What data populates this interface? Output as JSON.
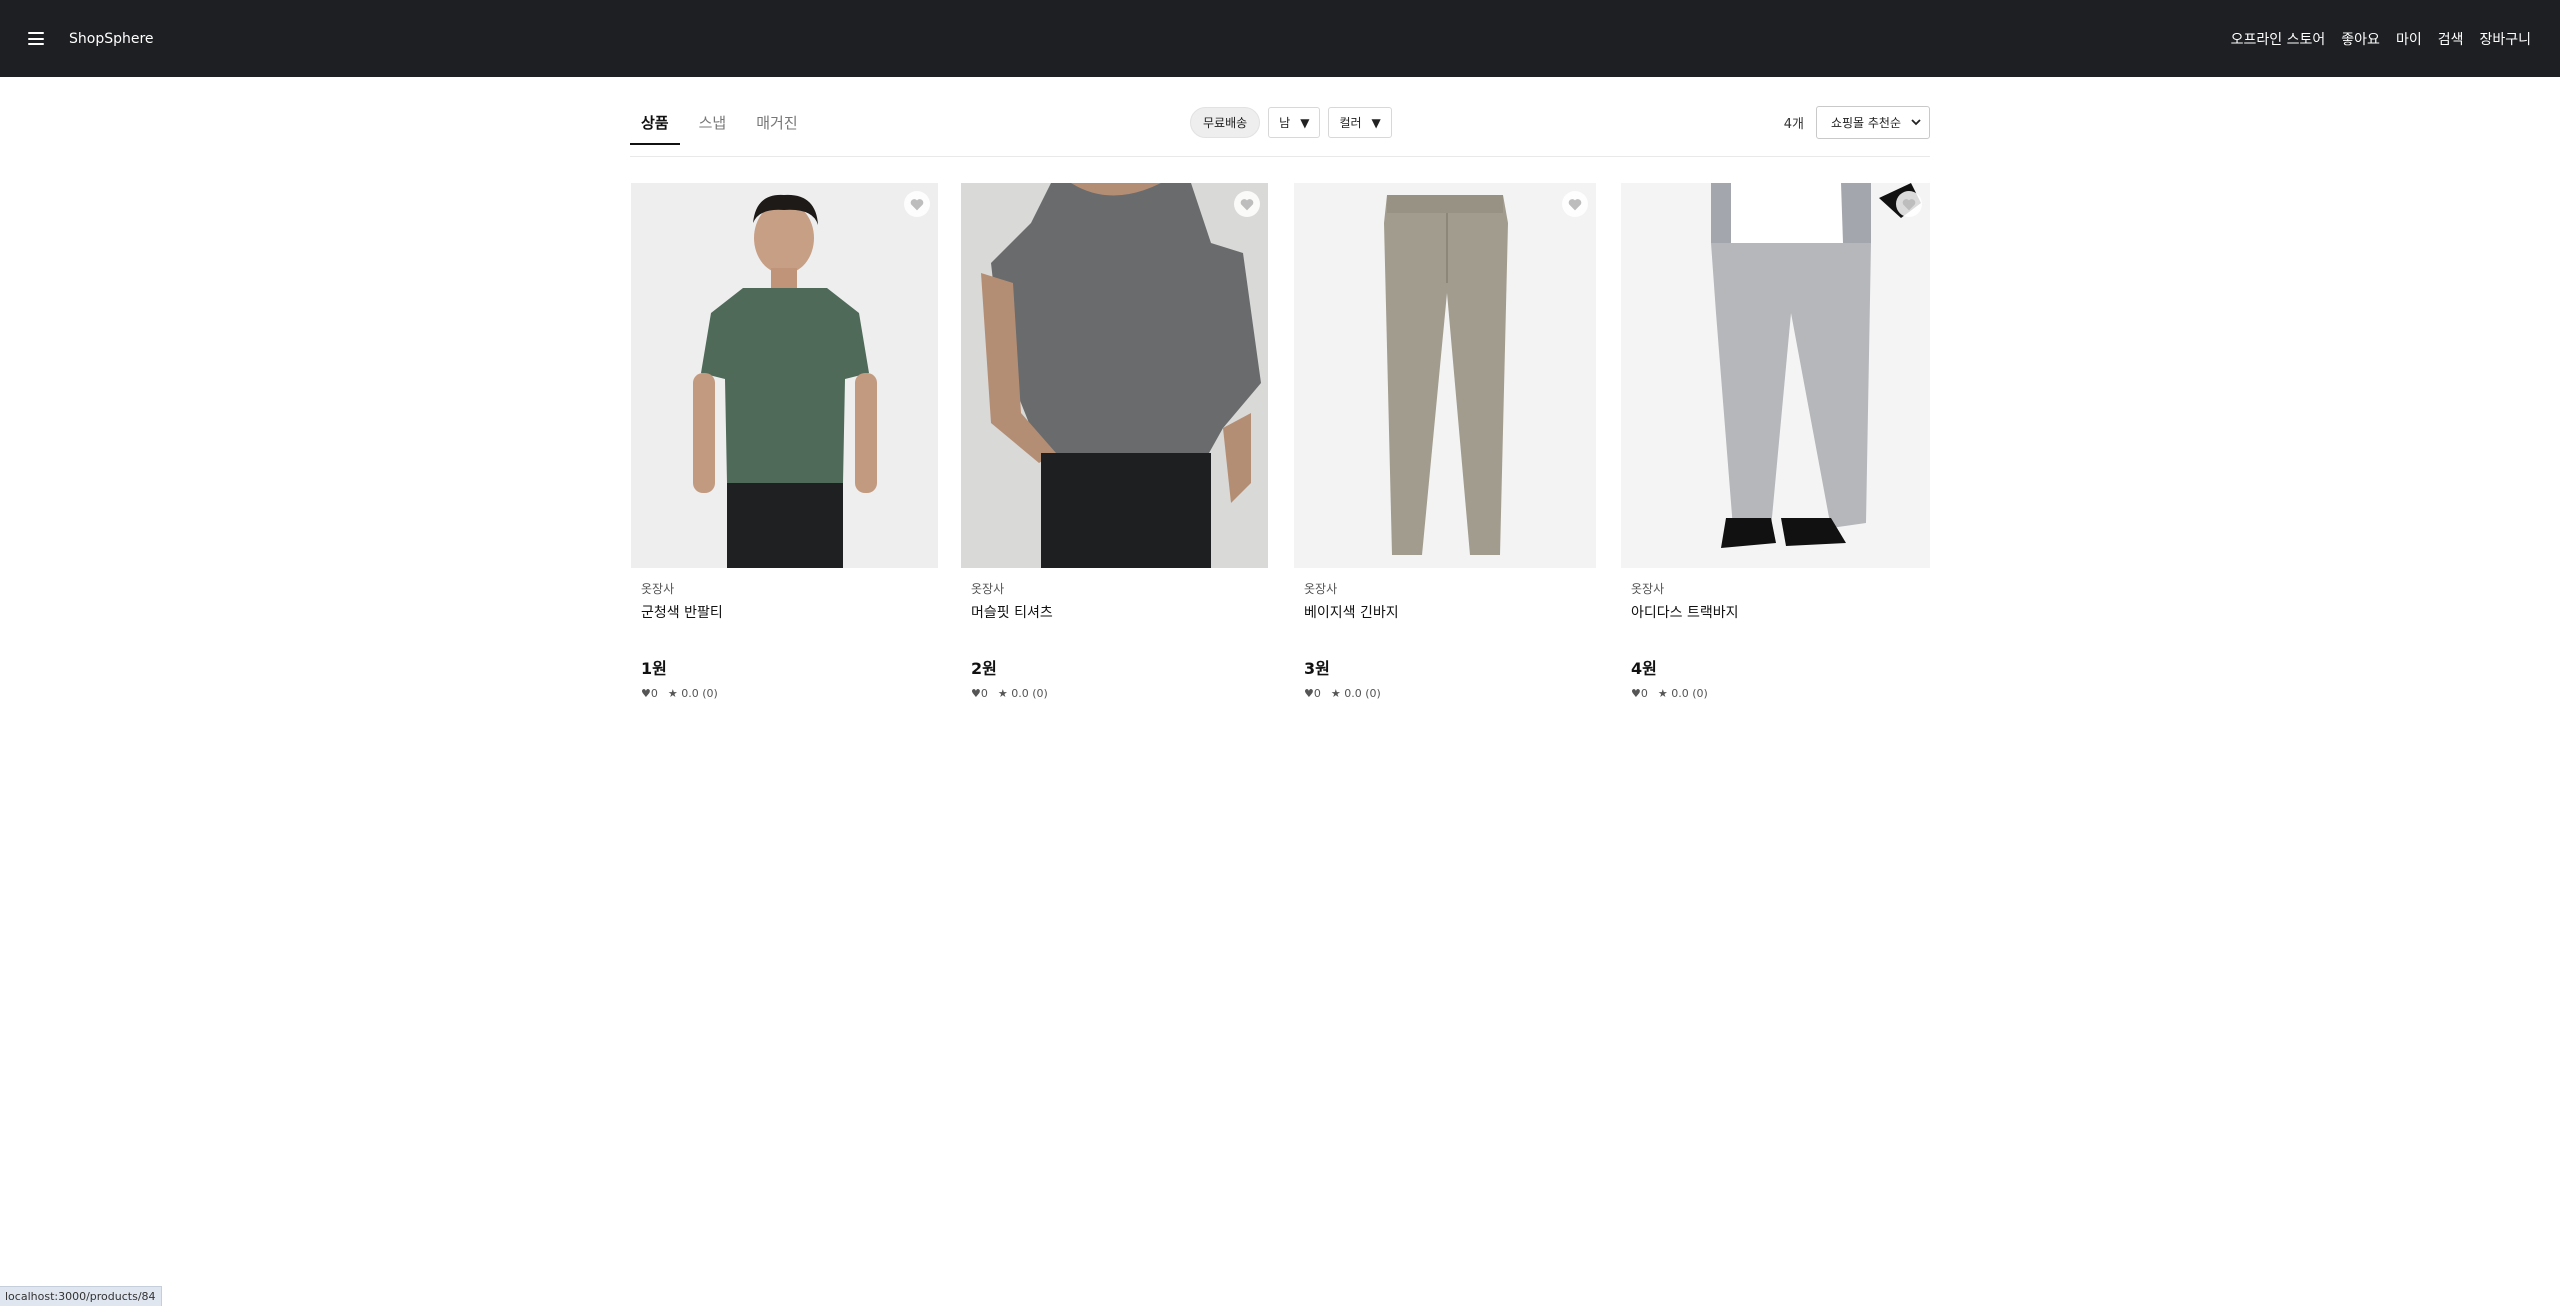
{
  "header": {
    "brand": "ShopSphere",
    "links": [
      "오프라인 스토어",
      "좋아요",
      "마이",
      "검색",
      "장바구니"
    ]
  },
  "tabs": [
    {
      "label": "상품",
      "active": true
    },
    {
      "label": "스냅",
      "active": false
    },
    {
      "label": "매거진",
      "active": false
    }
  ],
  "filters": {
    "free_shipping": "무료배송",
    "gender": "남",
    "color": "컬러",
    "caret": "▼"
  },
  "results": {
    "count": "4개",
    "sort_selected": "쇼핑몰 추천순"
  },
  "products": [
    {
      "store": "옷장사",
      "name": "군청색 반팔티",
      "price": "1원",
      "likes": "♥0",
      "rating": "★ 0.0 (0)",
      "image": "green-tshirt-model"
    },
    {
      "store": "옷장사",
      "name": "머슬핏 티셔츠",
      "price": "2원",
      "likes": "♥0",
      "rating": "★ 0.0 (0)",
      "image": "gray-muscle-tshirt"
    },
    {
      "store": "옷장사",
      "name": "베이지색 긴바지",
      "price": "3원",
      "likes": "♥0",
      "rating": "★ 0.0 (0)",
      "image": "beige-pants"
    },
    {
      "store": "옷장사",
      "name": "아디다스 트랙바지",
      "price": "4원",
      "likes": "♥0",
      "rating": "★ 0.0 (0)",
      "image": "gray-track-pants"
    }
  ],
  "status_bar": {
    "url": "localhost:3000/products/84"
  },
  "colors": {
    "header_bg": "#1e1f22",
    "tshirt_green": "#4f6a58",
    "tshirt_gray": "#6a6b6d",
    "pants_beige": "#a29c8e",
    "pants_gray": "#b5b7ba"
  },
  "icons": {
    "menu": "hamburger-icon",
    "like": "heart-icon",
    "rating": "star-icon",
    "sort": "chevron-down-icon"
  }
}
